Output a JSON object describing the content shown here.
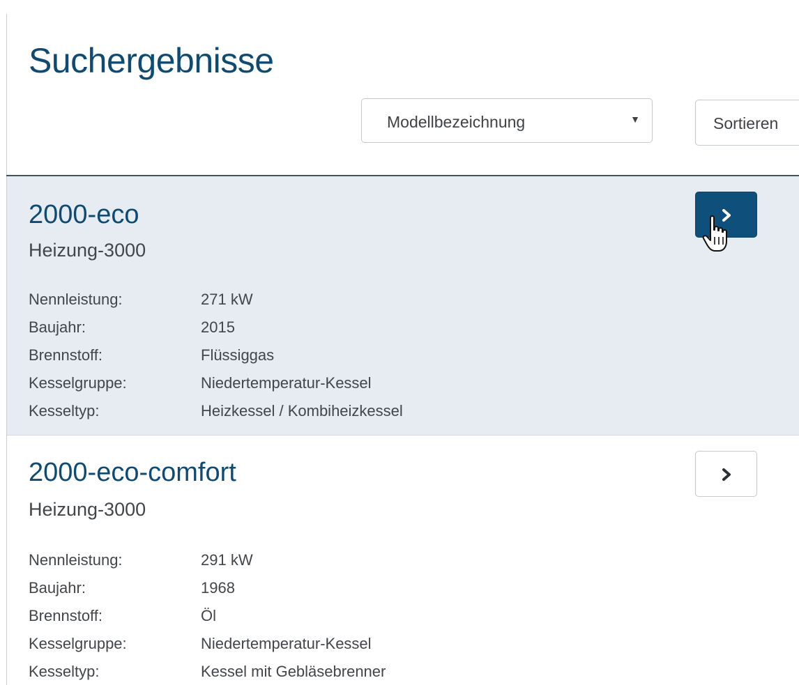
{
  "header": {
    "title": "Suchergebnisse"
  },
  "sort": {
    "selected": "Modellbezeichnung",
    "button_label": "Sortieren"
  },
  "results": [
    {
      "title": "2000-eco",
      "subtitle": "Heizung-3000",
      "highlighted": true,
      "details": [
        {
          "key": "Nennleistung:",
          "value": "271 kW"
        },
        {
          "key": "Baujahr:",
          "value": "2015"
        },
        {
          "key": "Brennstoff:",
          "value": "Flüssiggas"
        },
        {
          "key": "Kesselgruppe:",
          "value": "Niedertemperatur-Kessel"
        },
        {
          "key": "Kesseltyp:",
          "value": "Heizkessel / Kombiheizkessel"
        }
      ]
    },
    {
      "title": "2000-eco-comfort",
      "subtitle": "Heizung-3000",
      "highlighted": false,
      "details": [
        {
          "key": "Nennleistung:",
          "value": "291 kW"
        },
        {
          "key": "Baujahr:",
          "value": "1968"
        },
        {
          "key": "Brennstoff:",
          "value": "Öl"
        },
        {
          "key": "Kesselgruppe:",
          "value": "Niedertemperatur-Kessel"
        },
        {
          "key": "Kesseltyp:",
          "value": "Kessel mit Gebläsebrenner"
        }
      ]
    }
  ],
  "icons": {
    "select_arrow": "caret-down-icon",
    "open_result": "chevron-right-icon",
    "pointer": "hand-pointer-cursor-icon"
  },
  "colors": {
    "primary": "#0f4f7c",
    "title": "#0f4a72",
    "highlight_background": "#e6ecf1",
    "text": "#424549"
  }
}
